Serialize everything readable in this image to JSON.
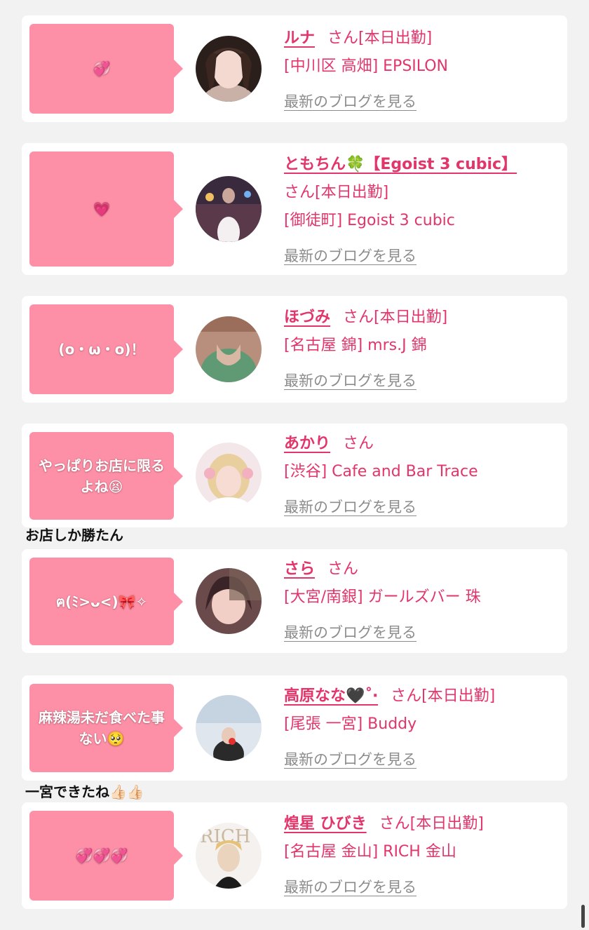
{
  "colors": {
    "bubble": "#fd8fa6",
    "accent": "#e3356a",
    "link_gray": "#8c8c8c",
    "card": "#ffffff",
    "background": "#f2f2f3"
  },
  "blog_link": "最新のブログを見る",
  "cards": [
    {
      "bubble": "💞",
      "name": "ルナ",
      "suffix": "さん[本日出勤]",
      "location": "[中川区 高畑] EPSILON"
    },
    {
      "bubble": "💗",
      "name": "ともちん🍀【Egoist 3 cubic】",
      "suffix": "さん[本日出勤]",
      "location": "[御徒町] Egoist 3 cubic"
    },
    {
      "bubble": "(o・ω・o)！",
      "name": "ほづみ",
      "suffix": "さん[本日出勤]",
      "location": "[名古屋 錦] mrs.J 錦"
    },
    {
      "bubble": "やっぱりお店に限るよね😫",
      "name": "あかり",
      "suffix": "さん",
      "location": "[渋谷] Cafe and Bar Trace"
    },
    {
      "bubble": "ฅ(ﾐ>ᴗ<)🎀✧",
      "name": "さら",
      "suffix": "さん",
      "location": "[大宮/南銀] ガールズバー 珠"
    },
    {
      "bubble": "麻辣湯未だ食べた事ない🥺",
      "name": "高原なな🖤˚‧",
      "suffix": "さん[本日出勤]",
      "location": "[尾張 一宮] Buddy"
    },
    {
      "bubble": "💞💞💞",
      "name": "煌星 ひびき",
      "suffix": "さん[本日出勤]",
      "location": "[名古屋 金山] RICH 金山"
    }
  ],
  "comments": [
    "お店しか勝たん",
    "一宮できたね👍🏻👍🏻"
  ]
}
